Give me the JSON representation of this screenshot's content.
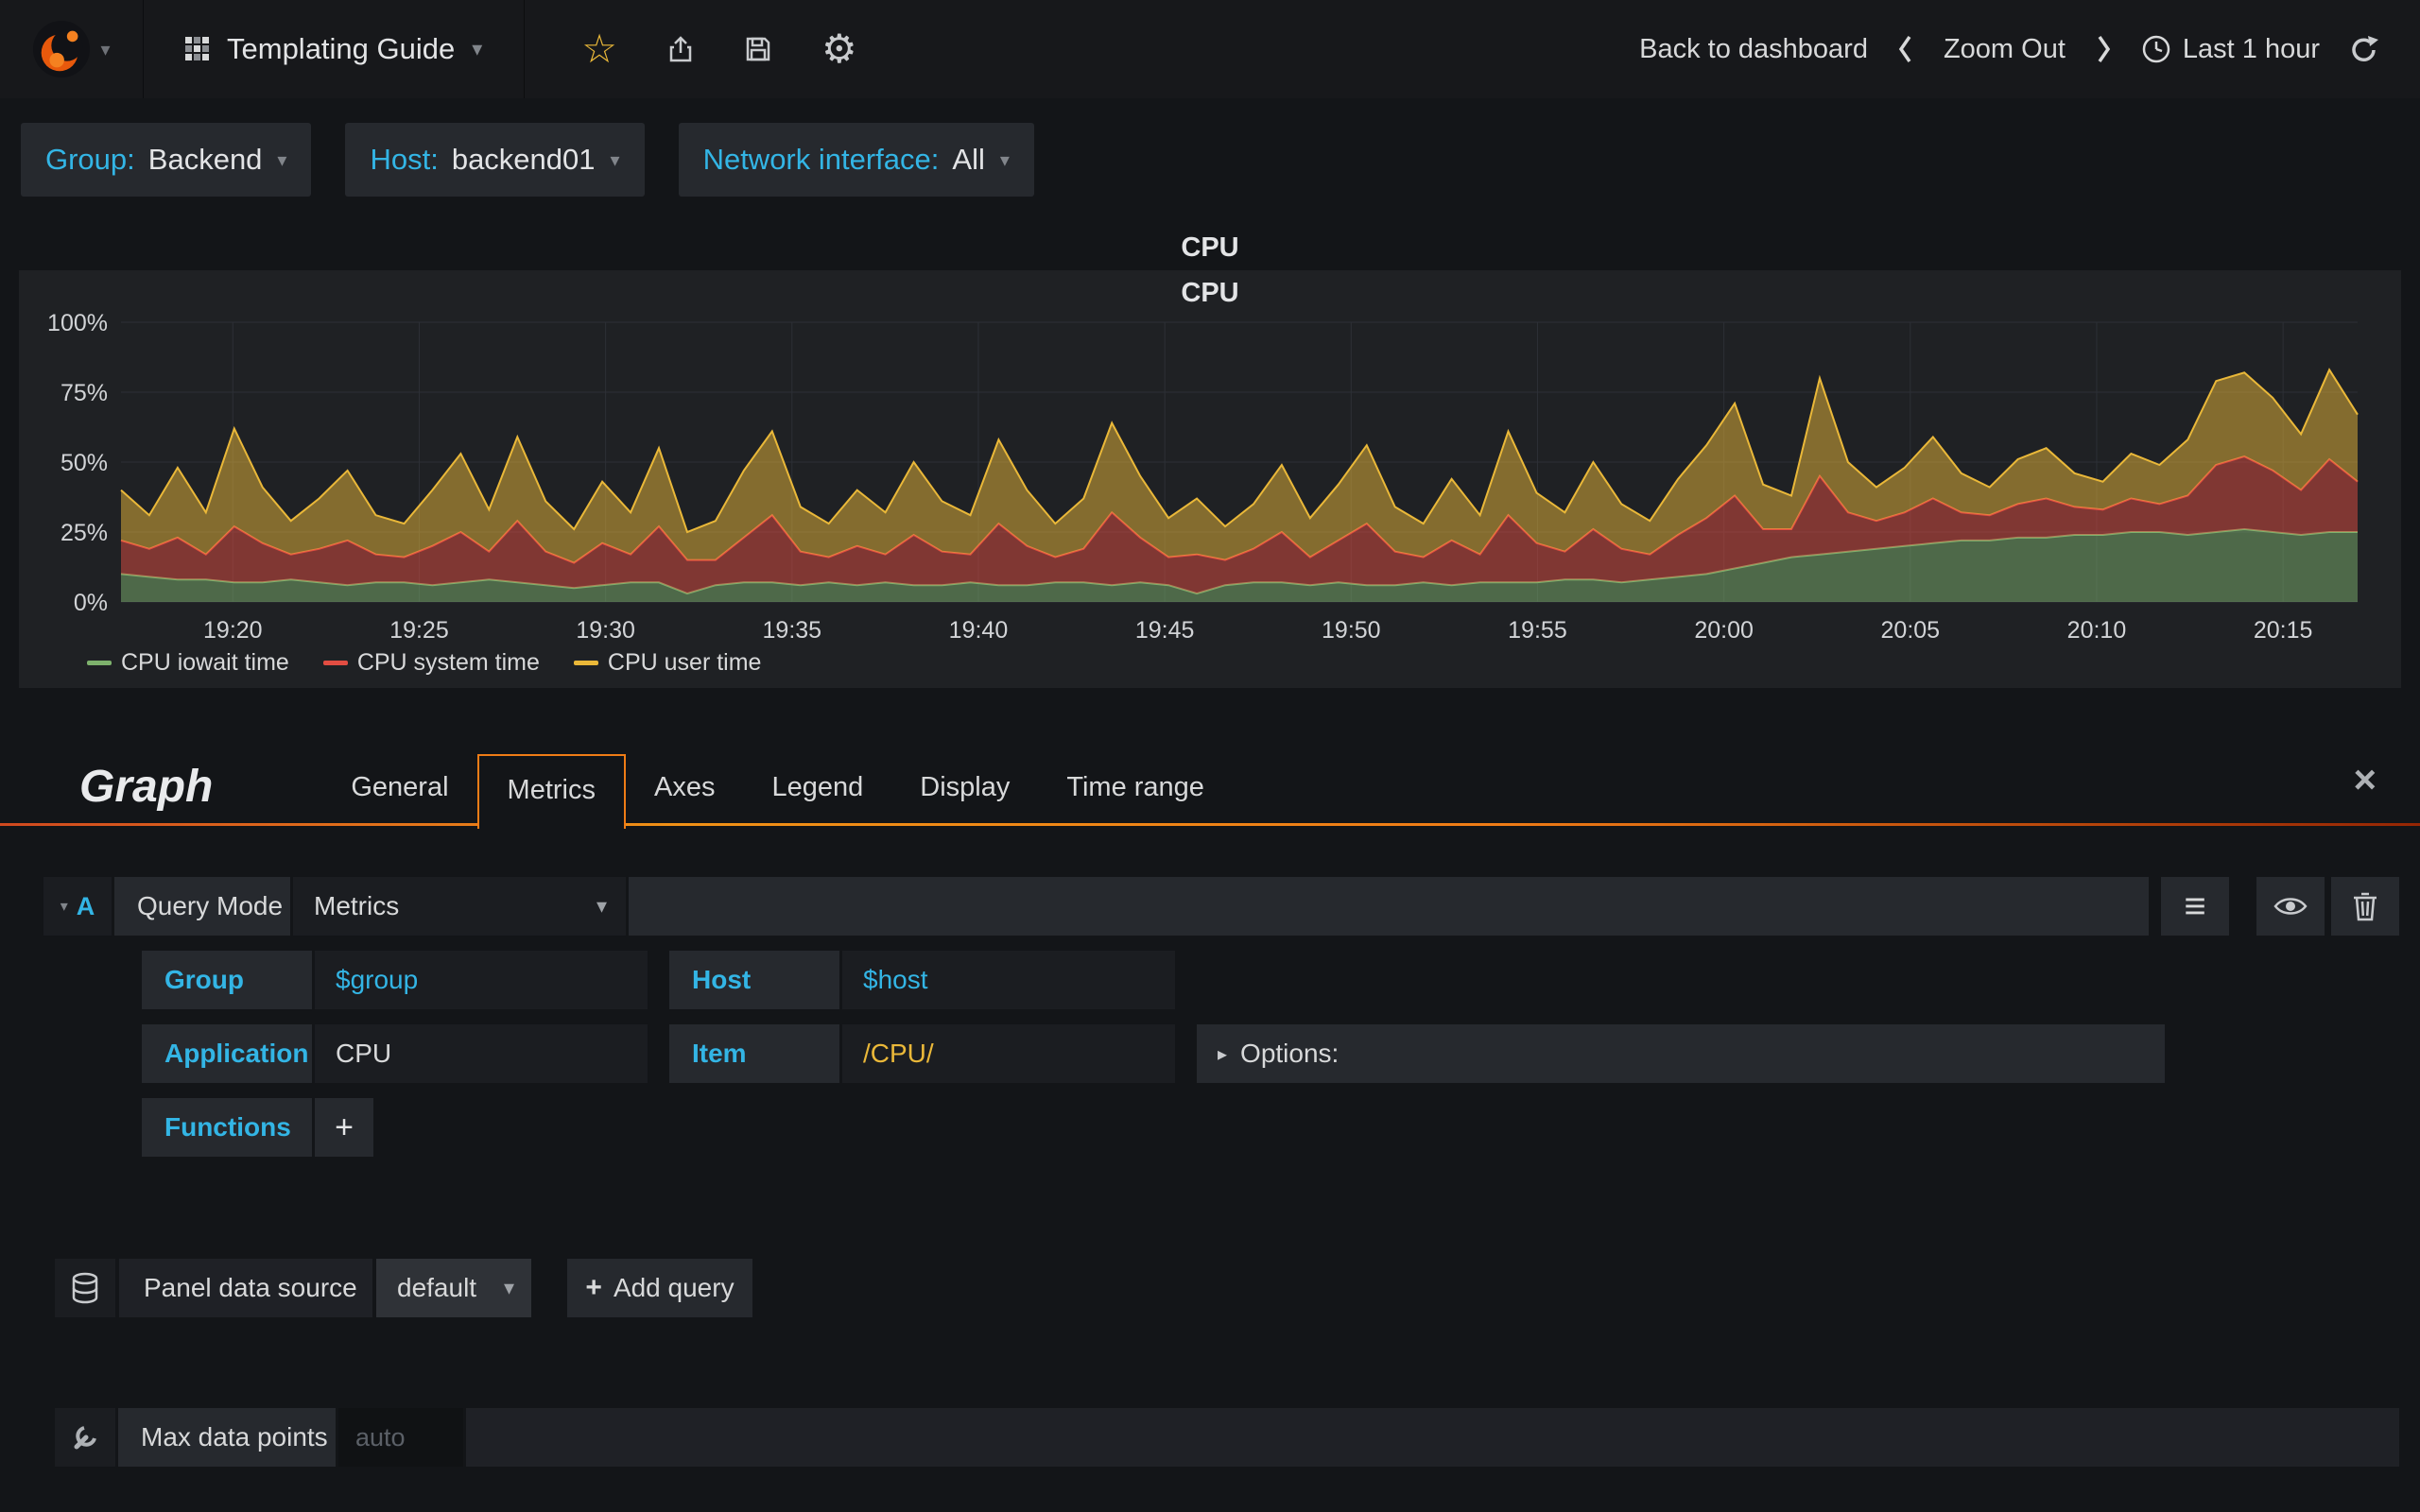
{
  "navbar": {
    "dashboard_title": "Templating Guide",
    "back_to_dashboard": "Back to dashboard",
    "zoom_out": "Zoom Out",
    "time_range": "Last 1 hour"
  },
  "variables": [
    {
      "label": "Group:",
      "value": "Backend"
    },
    {
      "label": "Host:",
      "value": "backend01"
    },
    {
      "label": "Network interface:",
      "value": "All"
    }
  ],
  "panel": {
    "header": "CPU"
  },
  "chart_data": {
    "type": "area",
    "stacked": true,
    "title": "CPU",
    "ylim": [
      0,
      100
    ],
    "y_ticks": [
      "0%",
      "25%",
      "50%",
      "75%",
      "100%"
    ],
    "x_ticks": [
      "19:20",
      "19:25",
      "19:30",
      "19:35",
      "19:40",
      "19:45",
      "19:50",
      "19:55",
      "20:00",
      "20:05",
      "20:10",
      "20:15"
    ],
    "x_range": [
      "19:17",
      "20:17"
    ],
    "grid": true,
    "legend_position": "bottom-left",
    "series": [
      {
        "name": "CPU iowait time",
        "color": "#7EB26D",
        "values": [
          10,
          9,
          8,
          8,
          7,
          7,
          8,
          7,
          6,
          7,
          7,
          6,
          7,
          8,
          7,
          6,
          5,
          6,
          7,
          7,
          3,
          6,
          7,
          7,
          6,
          7,
          6,
          7,
          6,
          6,
          7,
          6,
          6,
          7,
          7,
          6,
          7,
          6,
          3,
          6,
          7,
          7,
          6,
          7,
          6,
          6,
          7,
          6,
          7,
          7,
          7,
          8,
          8,
          7,
          8,
          9,
          10,
          12,
          14,
          16,
          17,
          18,
          19,
          20,
          21,
          22,
          22,
          23,
          23,
          24,
          24,
          25,
          25,
          24,
          25,
          26,
          25,
          24,
          25,
          25
        ]
      },
      {
        "name": "CPU system time",
        "color": "#E24D42",
        "values": [
          12,
          10,
          15,
          9,
          20,
          14,
          9,
          12,
          16,
          10,
          9,
          14,
          18,
          10,
          22,
          12,
          9,
          15,
          10,
          20,
          12,
          9,
          16,
          24,
          12,
          9,
          14,
          10,
          18,
          12,
          10,
          22,
          14,
          9,
          12,
          26,
          16,
          10,
          14,
          9,
          12,
          18,
          10,
          15,
          22,
          12,
          9,
          16,
          10,
          24,
          14,
          10,
          18,
          12,
          9,
          15,
          20,
          26,
          12,
          10,
          28,
          14,
          10,
          12,
          16,
          10,
          9,
          12,
          14,
          10,
          9,
          12,
          10,
          14,
          24,
          26,
          22,
          16,
          26,
          18
        ]
      },
      {
        "name": "CPU user time",
        "color": "#EAB839",
        "values": [
          18,
          12,
          25,
          15,
          35,
          20,
          12,
          18,
          25,
          14,
          12,
          20,
          28,
          15,
          30,
          18,
          12,
          22,
          15,
          28,
          10,
          14,
          24,
          30,
          16,
          12,
          20,
          15,
          26,
          18,
          14,
          30,
          20,
          12,
          18,
          32,
          22,
          14,
          20,
          12,
          16,
          24,
          14,
          20,
          28,
          16,
          12,
          22,
          14,
          30,
          18,
          14,
          24,
          16,
          12,
          20,
          26,
          33,
          16,
          12,
          35,
          18,
          12,
          16,
          22,
          14,
          10,
          16,
          18,
          12,
          10,
          16,
          14,
          20,
          30,
          30,
          26,
          20,
          32,
          24
        ]
      }
    ]
  },
  "editor": {
    "title": "Graph",
    "tabs": [
      "General",
      "Metrics",
      "Axes",
      "Legend",
      "Display",
      "Time range"
    ],
    "active_tab": "Metrics",
    "query": {
      "ref": "A",
      "mode_label": "Query Mode",
      "mode_value": "Metrics",
      "group_label": "Group",
      "group_value": "$group",
      "host_label": "Host",
      "host_value": "$host",
      "application_label": "Application",
      "application_value": "CPU",
      "item_label": "Item",
      "item_value": "/CPU/",
      "options_label": "Options:",
      "functions_label": "Functions"
    },
    "datasource": {
      "label": "Panel data source",
      "value": "default",
      "add_query": "Add query"
    },
    "max_data_points": {
      "label": "Max data points",
      "placeholder": "auto"
    }
  },
  "glyphs": {
    "caret_down": "▾",
    "caret_right": "▸",
    "close": "×",
    "plus": "+",
    "star": "☆",
    "gear": "⚙",
    "menu": "≡"
  }
}
